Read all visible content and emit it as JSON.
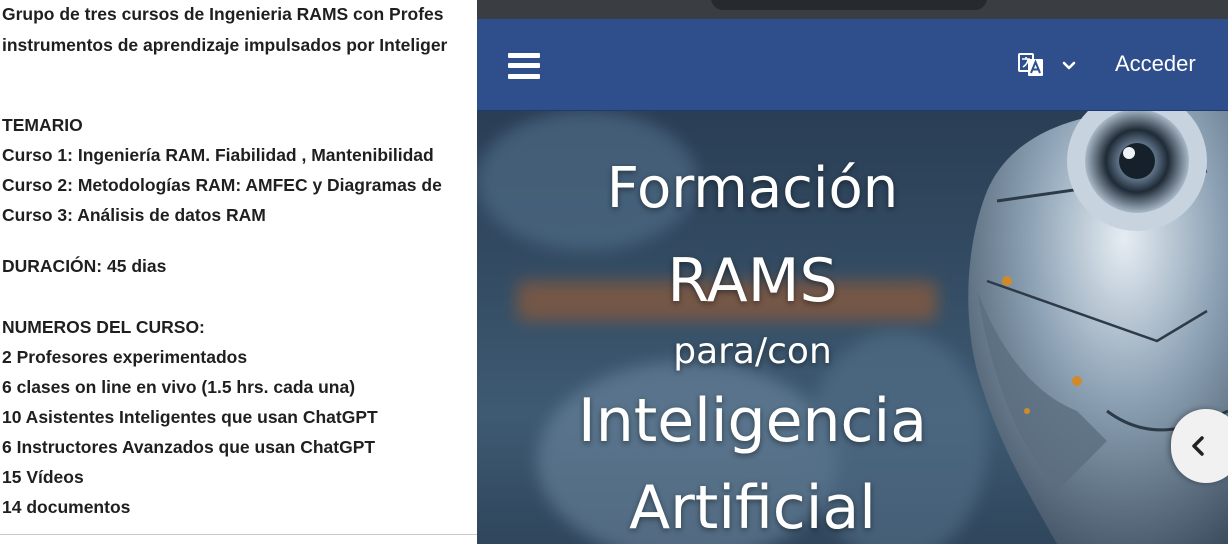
{
  "document": {
    "intro_line_1": "Grupo de tres cursos de Ingenieria RAMS con Profes",
    "intro_line_2": "instrumentos de aprendizaje impulsados por Inteliger",
    "syllabus_heading": "TEMARIO",
    "course_1": "Curso 1:  Ingeniería RAM. Fiabilidad , Mantenibilidad",
    "course_2": "Curso 2: Metodologías RAM: AMFEC y Diagramas de",
    "course_3": "Curso 3: Análisis de datos RAM",
    "duration": "DURACIÓN: 45 dias",
    "numbers_heading": "NUMEROS DEL CURSO:",
    "stats": [
      "2 Profesores experimentados",
      "6 clases on line en vivo (1.5 hrs. cada una)",
      "10 Asistentes Inteligentes que usan ChatGPT",
      "6 Instructores Avanzados que usan ChatGPT",
      "15 Vídeos",
      "14 documentos"
    ]
  },
  "preview": {
    "navbar": {
      "menu_icon": "hamburger-menu-icon",
      "language_icon": "translate-icon",
      "language_chevron": "chevron-down-icon",
      "login_label": "Acceder"
    },
    "hero": {
      "line_1": "Formación",
      "line_2": "RAMS",
      "line_3": "para/con",
      "line_4": "Inteligencia",
      "line_5": "Artificial"
    },
    "side_tab_icon": "chevron-left-icon"
  },
  "colors": {
    "navbar": "#2e4f8c",
    "document_text": "#1f1f1f",
    "hero_text": "#ffffff"
  }
}
